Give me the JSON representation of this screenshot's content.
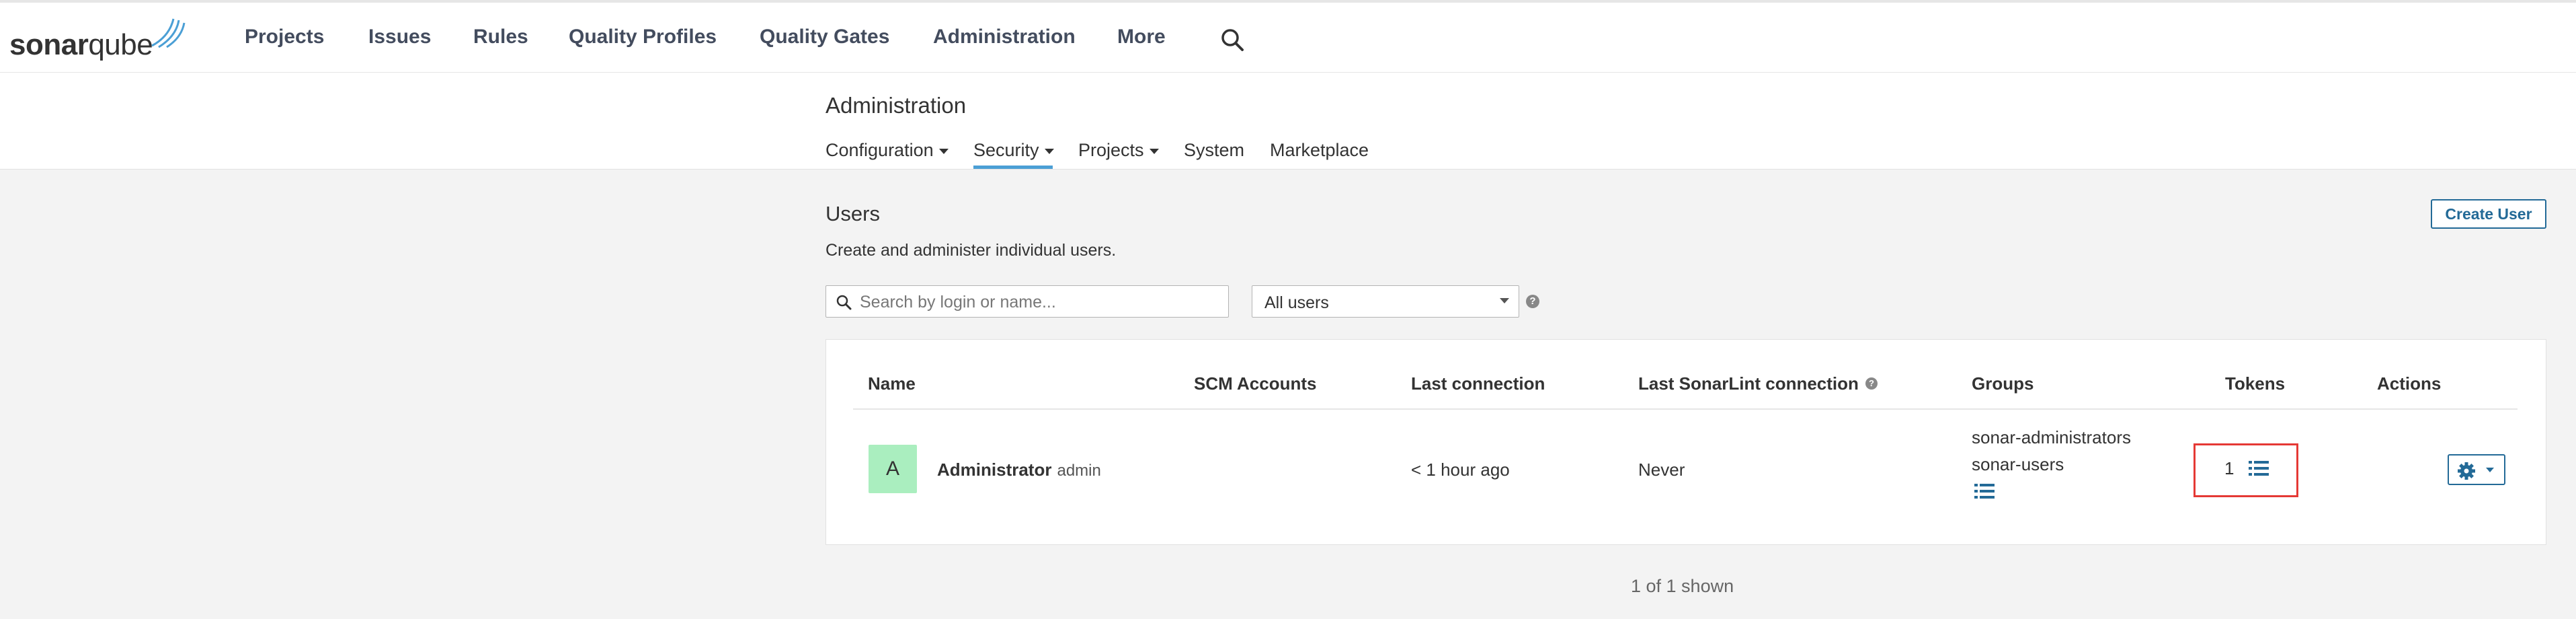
{
  "topnav": {
    "logo_bold": "sonar",
    "logo_light": "qube",
    "items": [
      "Projects",
      "Issues",
      "Rules",
      "Quality Profiles",
      "Quality Gates",
      "Administration",
      "More"
    ],
    "search_icon": "search-icon"
  },
  "admin": {
    "title": "Administration",
    "tabs": [
      {
        "label": "Configuration",
        "has_dropdown": true
      },
      {
        "label": "Security",
        "has_dropdown": true,
        "active": true
      },
      {
        "label": "Projects",
        "has_dropdown": true
      },
      {
        "label": "System",
        "has_dropdown": false
      },
      {
        "label": "Marketplace",
        "has_dropdown": false
      }
    ]
  },
  "users": {
    "title": "Users",
    "description": "Create and administer individual users.",
    "create_button": "Create User",
    "search_placeholder": "Search by login or name...",
    "filter_selected": "All users",
    "table": {
      "headers": {
        "name": "Name",
        "scm": "SCM Accounts",
        "last_connection": "Last connection",
        "last_sonarlint": "Last SonarLint connection",
        "groups": "Groups",
        "tokens": "Tokens",
        "actions": "Actions"
      },
      "rows": [
        {
          "avatar_initial": "A",
          "name": "Administrator",
          "login": "admin",
          "scm_accounts": "",
          "last_connection": "< 1 hour ago",
          "last_sonarlint": "Never",
          "groups": [
            "sonar-administrators",
            "sonar-users"
          ],
          "tokens": "1"
        }
      ]
    },
    "shown_count": "1 of 1 shown"
  },
  "colors": {
    "accent": "#236a97",
    "active_tab_underline": "#4b9fd5",
    "avatar_bg": "#aaeebf",
    "highlight_box": "#e53935"
  }
}
